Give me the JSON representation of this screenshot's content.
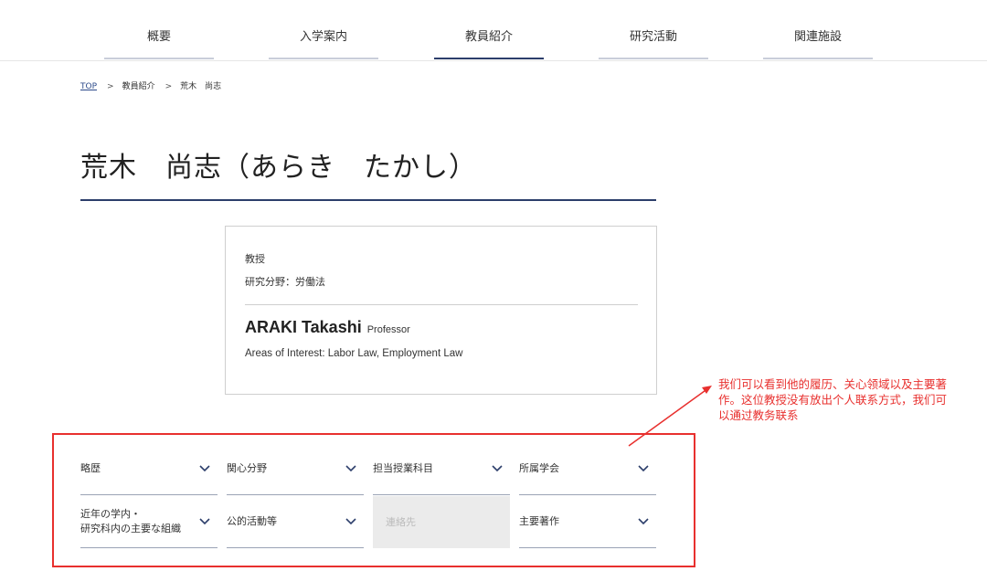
{
  "nav": {
    "items": [
      {
        "label": "概要"
      },
      {
        "label": "入学案内"
      },
      {
        "label": "教員紹介"
      },
      {
        "label": "研究活動"
      },
      {
        "label": "関連施設"
      }
    ]
  },
  "breadcrumb": {
    "items": [
      "TOP",
      "教員紹介",
      "荒木　尚志"
    ],
    "separator": ">"
  },
  "page": {
    "title": "荒木　尚志（あらき　たかし）"
  },
  "profile": {
    "position_jp": "教授",
    "field_jp": "研究分野：労働法",
    "name_en": "ARAKI Takashi",
    "title_en": "Professor",
    "interest_en": "Areas of Interest: Labor Law, Employment Law"
  },
  "annotation": {
    "note": "我们可以看到他的履历、关心领域以及主要著作。这位教授没有放出个人联系方式，我们可以通过教务联系",
    "color": "#e8302e"
  },
  "sections": [
    {
      "label": "略歴",
      "disabled": false
    },
    {
      "label": "関心分野",
      "disabled": false
    },
    {
      "label": "担当授業科目",
      "disabled": false
    },
    {
      "label": "所属学会",
      "disabled": false
    },
    {
      "label": "近年の学内・",
      "label2": "研究科内の主要な組織",
      "disabled": false
    },
    {
      "label": "公的活動等",
      "disabled": false
    },
    {
      "label": "連絡先",
      "disabled": true
    },
    {
      "label": "主要著作",
      "disabled": false
    }
  ],
  "colors": {
    "accent": "#2c3e6b",
    "link": "#2c4a8a"
  }
}
